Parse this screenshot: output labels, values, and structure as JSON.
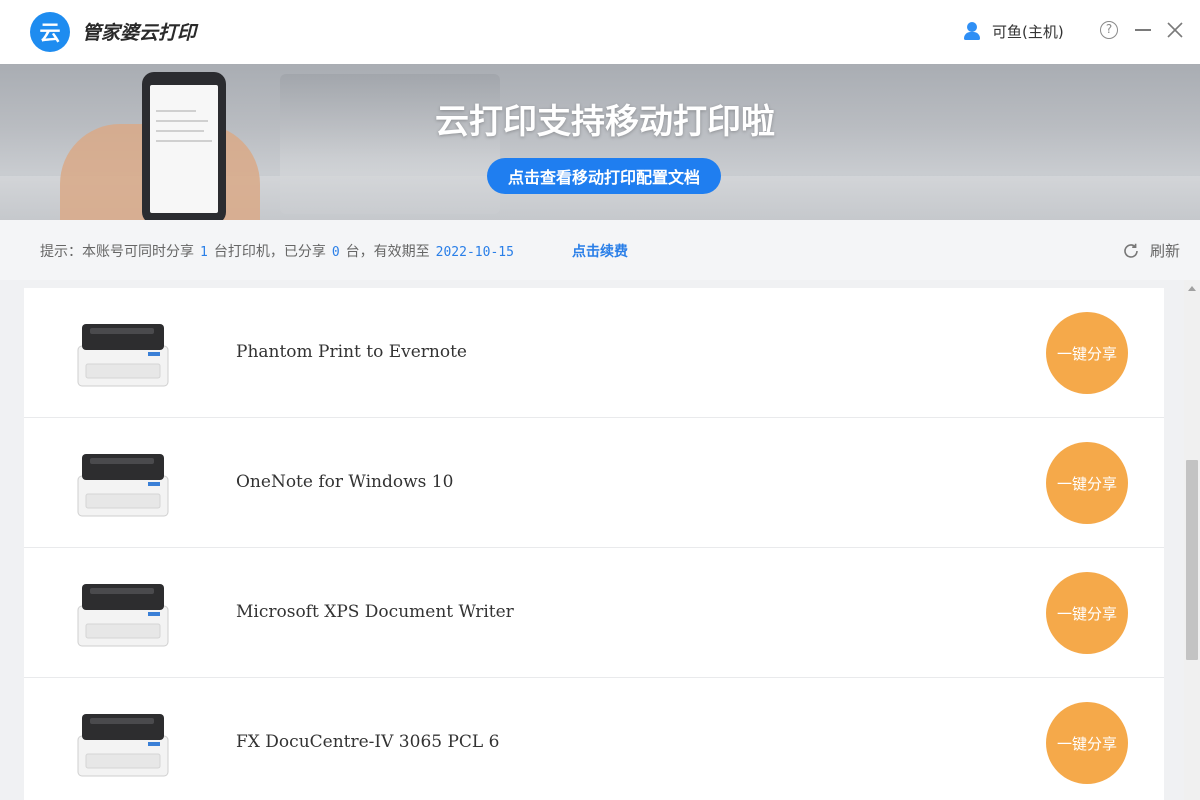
{
  "app": {
    "logo_char": "云",
    "title": "管家婆云打印"
  },
  "user": {
    "name": "可鱼(主机)"
  },
  "window_controls": {
    "help_glyph": "?"
  },
  "banner": {
    "title": "云打印支持移动打印啦",
    "button_label": "点击查看移动打印配置文档"
  },
  "info": {
    "prefix": "提示：本账号可同时分享",
    "share_limit": "1",
    "mid1": "台打印机，已分享",
    "shared_count": "0",
    "mid2": "台，有效期至",
    "expiry_date": "2022-10-15",
    "renew_label": "点击续费",
    "refresh_label": "刷新"
  },
  "printers": [
    {
      "name": "Phantom Print to Evernote",
      "share_label": "一键分享"
    },
    {
      "name": "OneNote for Windows 10",
      "share_label": "一键分享"
    },
    {
      "name": "Microsoft XPS Document Writer",
      "share_label": "一键分享"
    },
    {
      "name": "FX DocuCentre-IV 3065 PCL 6",
      "share_label": "一键分享"
    }
  ],
  "colors": {
    "brand_blue": "#1e8cf0",
    "link_blue": "#2a7fe8",
    "share_orange": "#f5a94a"
  }
}
